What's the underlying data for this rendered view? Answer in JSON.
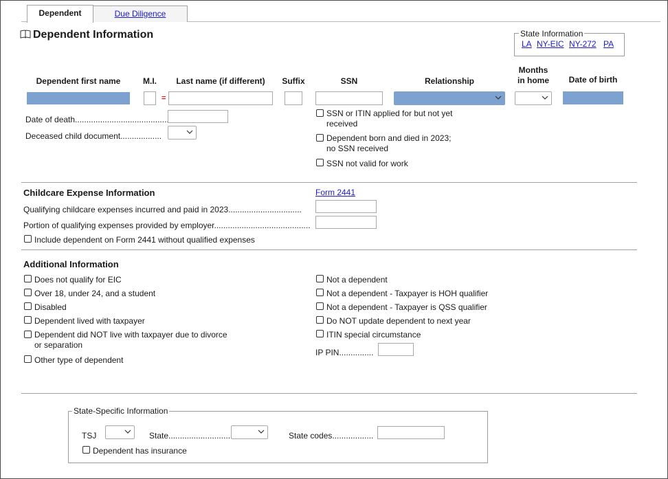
{
  "tabs": [
    {
      "label": "Dependent"
    },
    {
      "label": "Due Diligence"
    }
  ],
  "page_title": "Dependent Information",
  "state_information": {
    "label": "State Information",
    "links": [
      "LA",
      "NY-EIC",
      "NY-272",
      "PA"
    ]
  },
  "columns": {
    "first_name": "Dependent first name",
    "mi": "M.I.",
    "last_name": "Last name (if different)",
    "suffix": "Suffix",
    "ssn": "SSN",
    "relationship": "Relationship",
    "months_line1": "Months",
    "months_line2": "in home",
    "dob": "Date of birth"
  },
  "equals_marker": "=",
  "date_of_death": "Date of death.........................................",
  "deceased_doc": "Deceased child document..................",
  "ssn_checks": [
    {
      "line1": "SSN or ITIN applied for but not yet",
      "line2": "received"
    },
    {
      "line1": "Dependent born and died in 2023;",
      "line2": "no SSN received"
    },
    {
      "line1": "SSN not valid for work",
      "line2": ""
    }
  ],
  "childcare": {
    "title": "Childcare Expense Information",
    "form_link": "Form 2441",
    "expenses_label": "Qualifying childcare expenses incurred and paid in 2023................................",
    "employer_label": "Portion of qualifying expenses provided by employer..........................................",
    "include_label": "Include dependent on Form 2441 without qualified expenses"
  },
  "additional": {
    "title": "Additional Information",
    "left": [
      {
        "line1": "Does not qualify for EIC",
        "line2": ""
      },
      {
        "line1": "Over 18, under 24, and a student",
        "line2": ""
      },
      {
        "line1": "Disabled",
        "line2": ""
      },
      {
        "line1": "Dependent lived with taxpayer",
        "line2": ""
      },
      {
        "line1": "Dependent did NOT live with taxpayer due to divorce",
        "line2": "or separation"
      },
      {
        "line1": "Other type of dependent",
        "line2": ""
      }
    ],
    "right": [
      "Not a dependent",
      "Not a dependent - Taxpayer is HOH qualifier",
      "Not a dependent - Taxpayer is QSS qualifier",
      "Do NOT update dependent to next year",
      "ITIN special circumstance"
    ],
    "ip_pin": "IP PIN..............."
  },
  "state_specific": {
    "title": "State-Specific Information",
    "tsj": "TSJ",
    "state": "State............................",
    "state_codes": "State codes..................",
    "insurance": "Dependent has insurance"
  }
}
